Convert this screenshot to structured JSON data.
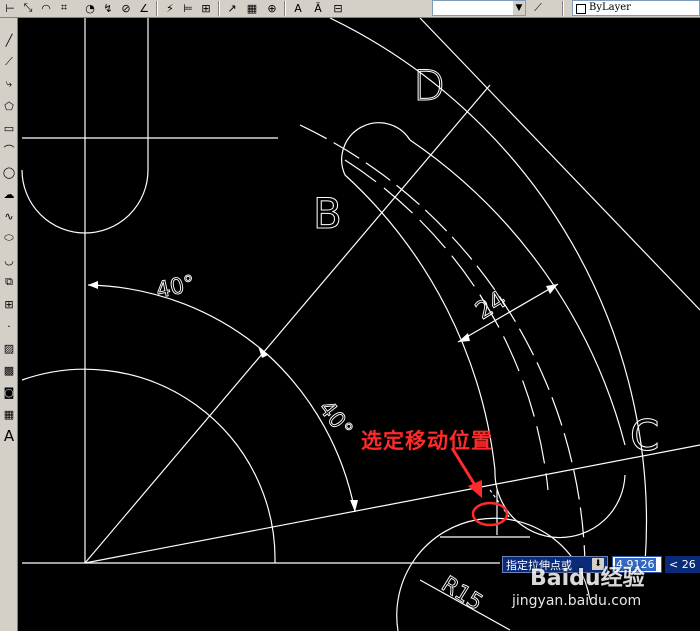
{
  "toolbar": {
    "property_color": "ByLayer",
    "icons": [
      "dim-linear-icon",
      "dim-aligned-icon",
      "dim-arc-icon",
      "dim-ordinate-icon",
      "dim-radius-icon",
      "dim-jogged-icon",
      "dim-diameter-icon",
      "dim-angular-icon",
      "quick-dim-icon",
      "baseline-icon",
      "continue-icon",
      "qleader-icon",
      "tolerance-icon",
      "center-mark-icon",
      "dim-edit-icon",
      "dim-text-edit-icon",
      "dim-update-icon",
      "dim-style-icon"
    ]
  },
  "left_toolbar": {
    "icons": [
      "line-icon",
      "construction-line-icon",
      "polyline-icon",
      "polygon-icon",
      "rectangle-icon",
      "arc-icon",
      "circle-icon",
      "revision-cloud-icon",
      "spline-icon",
      "ellipse-icon",
      "ellipse-arc-icon",
      "insert-block-icon",
      "make-block-icon",
      "point-icon",
      "hatch-icon",
      "gradient-icon",
      "region-icon",
      "table-icon",
      "multiline-text-icon"
    ],
    "text_tool_label": "A"
  },
  "drawing": {
    "labels": {
      "D": "D",
      "B": "B",
      "C": "C",
      "angle_outer": "40°",
      "angle_inner": "40°",
      "dim_24": "24",
      "radius": "R15"
    }
  },
  "annotation": {
    "callout_text": "选定移动位置",
    "color": "#ff2a2a"
  },
  "command_input": {
    "prompt": "指定拉伸点或",
    "value": "4.9126",
    "angle": "< 26"
  },
  "watermark": {
    "logo": "Baidu经验",
    "url": "jingyan.baidu.com"
  }
}
